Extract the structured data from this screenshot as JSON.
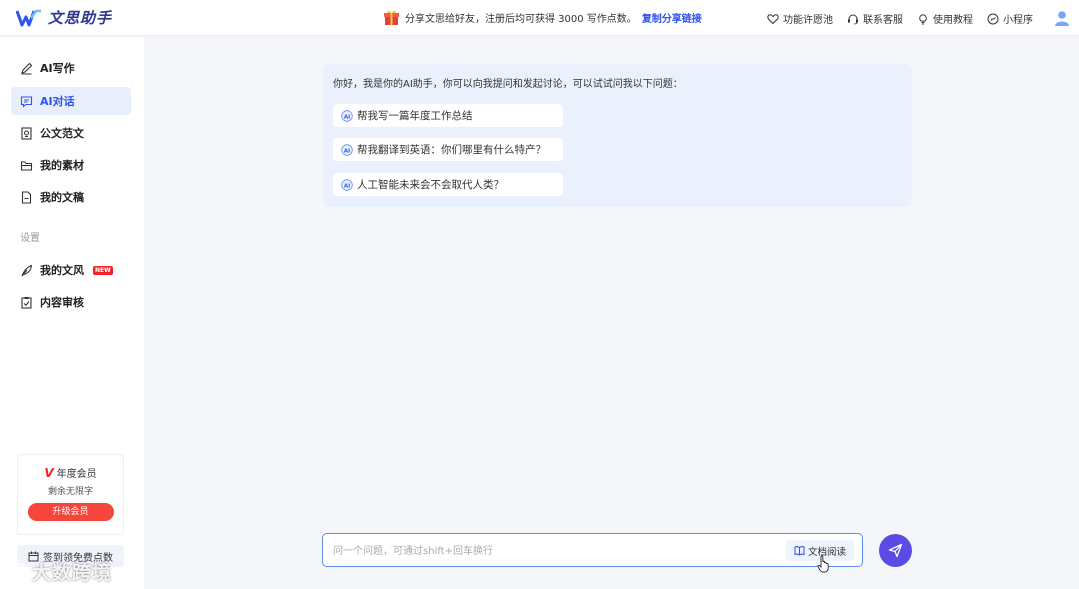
{
  "app": {
    "title": "文思助手",
    "icons": {
      "logo": "wenshi-logo-icon",
      "avatar": "user-avatar-icon"
    },
    "colors": {
      "accent": "#2f54eb",
      "send": "#5a4be6",
      "badge": "#f5222d",
      "panel": "#eaf0fc"
    }
  },
  "promo": {
    "text": "分享文思给好友，注册后均可获得 3000 写作点数。",
    "link": "复制分享链接",
    "icon": "gift-icon"
  },
  "top_actions": [
    {
      "label": "功能许愿池",
      "icon": "heart-icon"
    },
    {
      "label": "联系客服",
      "icon": "headset-icon"
    },
    {
      "label": "使用教程",
      "icon": "lightbulb-icon"
    },
    {
      "label": "小程序",
      "icon": "mini-program-icon"
    }
  ],
  "sidebar": {
    "items": [
      {
        "label": "AI写作",
        "icon": "pen-icon",
        "active": false
      },
      {
        "label": "AI对话",
        "icon": "chat-icon",
        "active": true
      },
      {
        "label": "公文范文",
        "icon": "document-seal-icon",
        "active": false
      },
      {
        "label": "我的素材",
        "icon": "folder-icon",
        "active": false
      },
      {
        "label": "我的文稿",
        "icon": "file-icon",
        "active": false
      }
    ],
    "section_label": "设置",
    "settings_items": [
      {
        "label": "我的文风",
        "icon": "feather-icon",
        "badge": "NEW"
      },
      {
        "label": "内容审核",
        "icon": "checklist-icon"
      }
    ],
    "vip": {
      "badge": "V",
      "title": "年度会员",
      "subtitle": "剩余无限字",
      "button": "升级会员"
    },
    "checkin": {
      "label": "签到领免费点数",
      "icon": "calendar-icon"
    }
  },
  "chat": {
    "greeting": "你好，我是你的AI助手，你可以向我提问和发起讨论，可以试试问我以下问题：",
    "suggestions": [
      "帮我写一篇年度工作总结",
      "帮我翻译到英语：你们哪里有什么特产？",
      "人工智能未来会不会取代人类？"
    ]
  },
  "input": {
    "placeholder": "问一个问题，可通过shift+回车换行",
    "value": "",
    "doc_button": "文档阅读"
  },
  "watermark": {
    "text": "大数跨境"
  }
}
